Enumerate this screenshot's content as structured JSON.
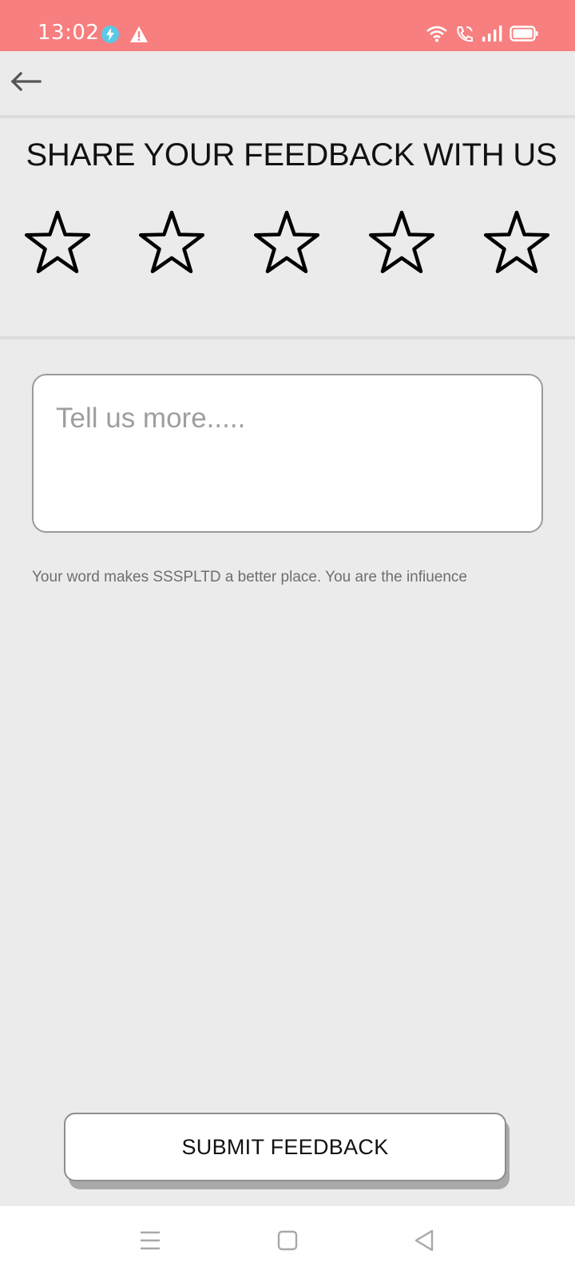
{
  "status_bar": {
    "time": "13:02",
    "left_icons": [
      "charging-bolt-icon",
      "warning-icon"
    ],
    "right_icons": [
      "wifi-icon",
      "wifi-call-icon",
      "signal-icon",
      "battery-icon"
    ],
    "background_color": "#f77f7f"
  },
  "app_bar": {
    "back_icon": "arrow-left-icon"
  },
  "feedback": {
    "title": "SHARE YOUR FEEDBACK WITH US",
    "rating": {
      "max": 5,
      "selected": 0
    },
    "input_placeholder": "Tell us more.....",
    "input_value": "",
    "helper_text": "Your word makes SSSPLTD a better place. You are the infiuence"
  },
  "submit": {
    "label": "SUBMIT FEEDBACK"
  },
  "nav_bar": {
    "items": [
      "menu-icon",
      "home-square-icon",
      "back-triangle-icon"
    ]
  }
}
